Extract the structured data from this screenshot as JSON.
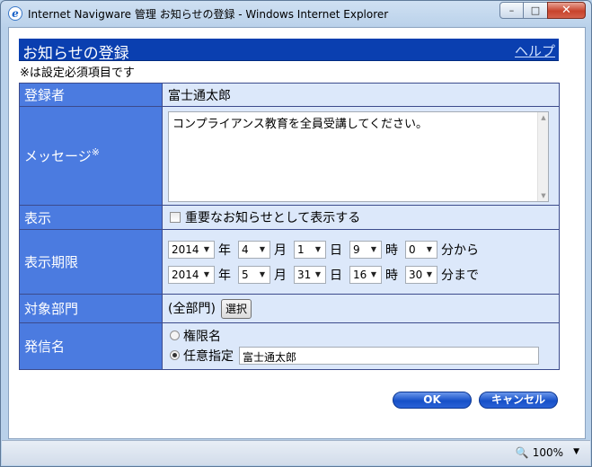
{
  "window": {
    "title": "Internet Navigware 管理 お知らせの登録 - Windows Internet Explorer",
    "minimize": "–",
    "maximize": "□",
    "close": "✕"
  },
  "header": {
    "title": "お知らせの登録",
    "help": "ヘルプ"
  },
  "required_note": "※は設定必須項目です",
  "form": {
    "registrant_label": "登録者",
    "registrant_value": "富士通太郎",
    "message_label": "メッセージ",
    "required_mark": "※",
    "message_value": "コンプライアンス教育を全員受講してください。",
    "display_label": "表示",
    "display_checkbox_label": "重要なお知らせとして表示する",
    "period_label": "表示期限",
    "units": {
      "year": "年",
      "month": "月",
      "day": "日",
      "hour": "時"
    },
    "start": {
      "year": "2014",
      "month": "4",
      "day": "1",
      "hour": "9",
      "minute": "0",
      "suffix": "分から"
    },
    "end": {
      "year": "2014",
      "month": "5",
      "day": "31",
      "hour": "16",
      "minute": "30",
      "suffix": "分まで"
    },
    "dept_label": "対象部門",
    "dept_value": "(全部門)",
    "dept_select_button": "選択",
    "sender_label": "発信名",
    "sender_option_authority": "権限名",
    "sender_option_custom": "任意指定",
    "sender_custom_value": "富士通太郎"
  },
  "buttons": {
    "ok": "OK",
    "cancel": "キャンセル"
  },
  "status": {
    "zoom": "100%"
  },
  "colors": {
    "header": "#0a3fb0",
    "label_bg": "#4b7be0",
    "value_bg": "#dce8fa"
  }
}
